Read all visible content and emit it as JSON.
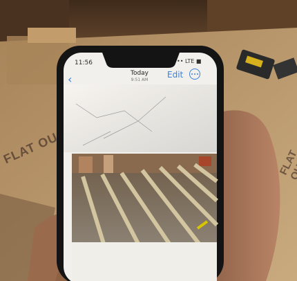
{
  "phone_screen": {
    "status_time": "11:56",
    "status_right": "•• LTE ■",
    "nav_title": "Today",
    "nav_subtitle": "9:51 AM",
    "edit_label": "Edit",
    "back_glyph": "‹"
  },
  "background": {
    "floor_print": "FLAT OU",
    "floor_print_2": "FLAT OU"
  },
  "colors": {
    "ios_accent": "#3b7fd9",
    "phone_frame": "#141414",
    "wood_wall": "#5a3e28",
    "osb_floor": "#b7946a"
  }
}
